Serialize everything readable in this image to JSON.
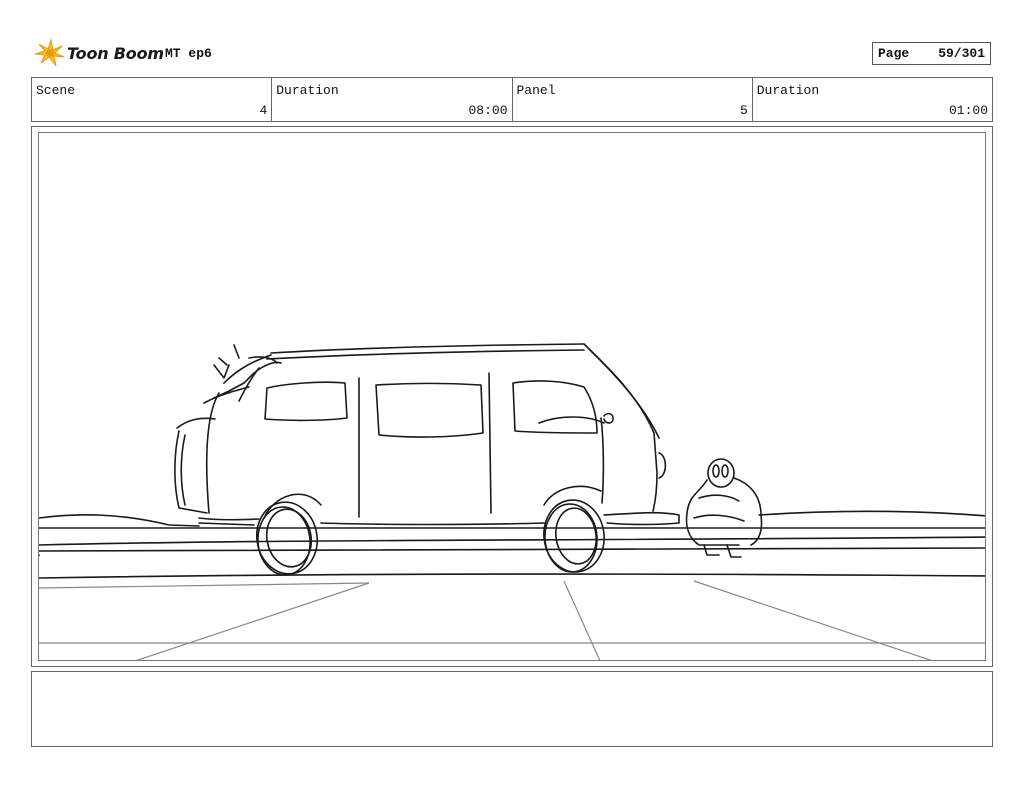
{
  "header": {
    "brand": "Toon Boom",
    "logo_icon": "starburst-logo-icon",
    "project": "MT ep6",
    "page_label": "Page",
    "page_value": "59/301"
  },
  "info": {
    "scene_label": "Scene",
    "scene_value": "4",
    "scene_duration_label": "Duration",
    "scene_duration_value": "08:00",
    "panel_label": "Panel",
    "panel_value": "5",
    "panel_duration_label": "Duration",
    "panel_duration_value": "01:00"
  },
  "colors": {
    "logo_yellow": "#f2c31b",
    "logo_orange": "#e89a16",
    "sketch_ink": "#1a1a1a",
    "guide_gray": "#888888"
  }
}
